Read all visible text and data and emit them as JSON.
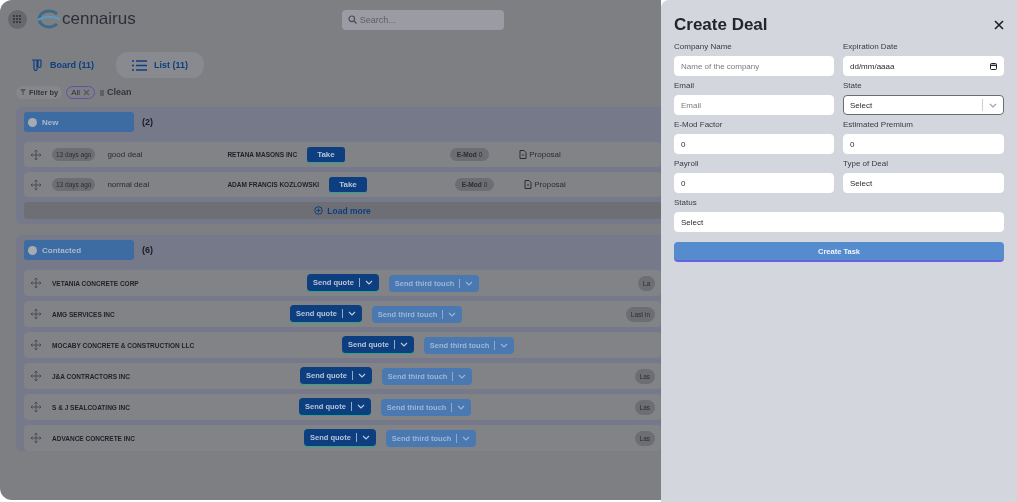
{
  "header": {
    "logo_text": "cennairus",
    "search": {
      "placeholder": "Search..."
    }
  },
  "view_tabs": [
    {
      "label": "Board (11)",
      "kind": "board",
      "selected": false
    },
    {
      "label": "List (11)",
      "kind": "list",
      "selected": true
    }
  ],
  "filter": {
    "label": "Filter by",
    "chips": [
      {
        "label": "All"
      }
    ],
    "clear": "Clean"
  },
  "groups": [
    {
      "name": "New",
      "count": "(2)",
      "kind": "new",
      "load_more": "Load more",
      "rows": [
        {
          "age": "13 days ago",
          "title": "good deal",
          "company": "RETANA MASONS INC",
          "action": "Take",
          "emod_label": "E-Mod",
          "emod_value": "0",
          "document": "Proposal"
        },
        {
          "age": "13 days ago",
          "title": "normal deal",
          "company": "ADAM FRANCIS KOZLOWSKI",
          "action": "Take",
          "emod_label": "E-Mod",
          "emod_value": "0",
          "document": "Proposal"
        }
      ]
    },
    {
      "name": "Contacted",
      "count": "(6)",
      "kind": "contacted",
      "rows": [
        {
          "company": "VETANIA CONCRETE CORP",
          "primary": "Send quote",
          "secondary": "Send third touch",
          "last_activity": "La"
        },
        {
          "company": "AMG SERVICES INC",
          "primary": "Send quote",
          "secondary": "Send third touch",
          "last_activity": "Last in"
        },
        {
          "company": "MOCABY CONCRETE & CONSTRUCTION LLC",
          "primary": "Send quote",
          "secondary": "Send third touch"
        },
        {
          "company": "J&A CONTRACTORS INC",
          "primary": "Send quote",
          "secondary": "Send third touch",
          "last_activity": "Las"
        },
        {
          "company": "S & J SEALCOATING INC",
          "primary": "Send quote",
          "secondary": "Send third touch",
          "last_activity": "Las"
        },
        {
          "company": "ADVANCE CONCRETE INC",
          "primary": "Send quote",
          "secondary": "Send third touch",
          "last_activity": "Las"
        }
      ]
    }
  ],
  "dialog": {
    "title": "Create Deal",
    "fields": [
      {
        "label": "Company Name",
        "kind": "text",
        "placeholder": "Name of the company",
        "focused": false
      },
      {
        "label": "Expiration Date",
        "kind": "date",
        "value": "dd/mm/aaaa",
        "focused": false
      },
      {
        "label": "Email",
        "kind": "text",
        "placeholder": "Email",
        "focused": false
      },
      {
        "label": "State",
        "kind": "combobox",
        "value": "Select",
        "focused": true
      },
      {
        "label": "E-Mod Factor",
        "kind": "text",
        "value": "0",
        "focused": false
      },
      {
        "label": "Estimated Premium",
        "kind": "text",
        "value": "0",
        "focused": false
      },
      {
        "label": "Payroll",
        "kind": "text",
        "value": "0",
        "focused": false
      },
      {
        "label": "Type of Deal",
        "kind": "select",
        "value": "Select",
        "focused": false
      },
      {
        "label": "Status",
        "kind": "wide-select",
        "value": "Select",
        "focused": false
      }
    ],
    "submit": "Create Task"
  }
}
